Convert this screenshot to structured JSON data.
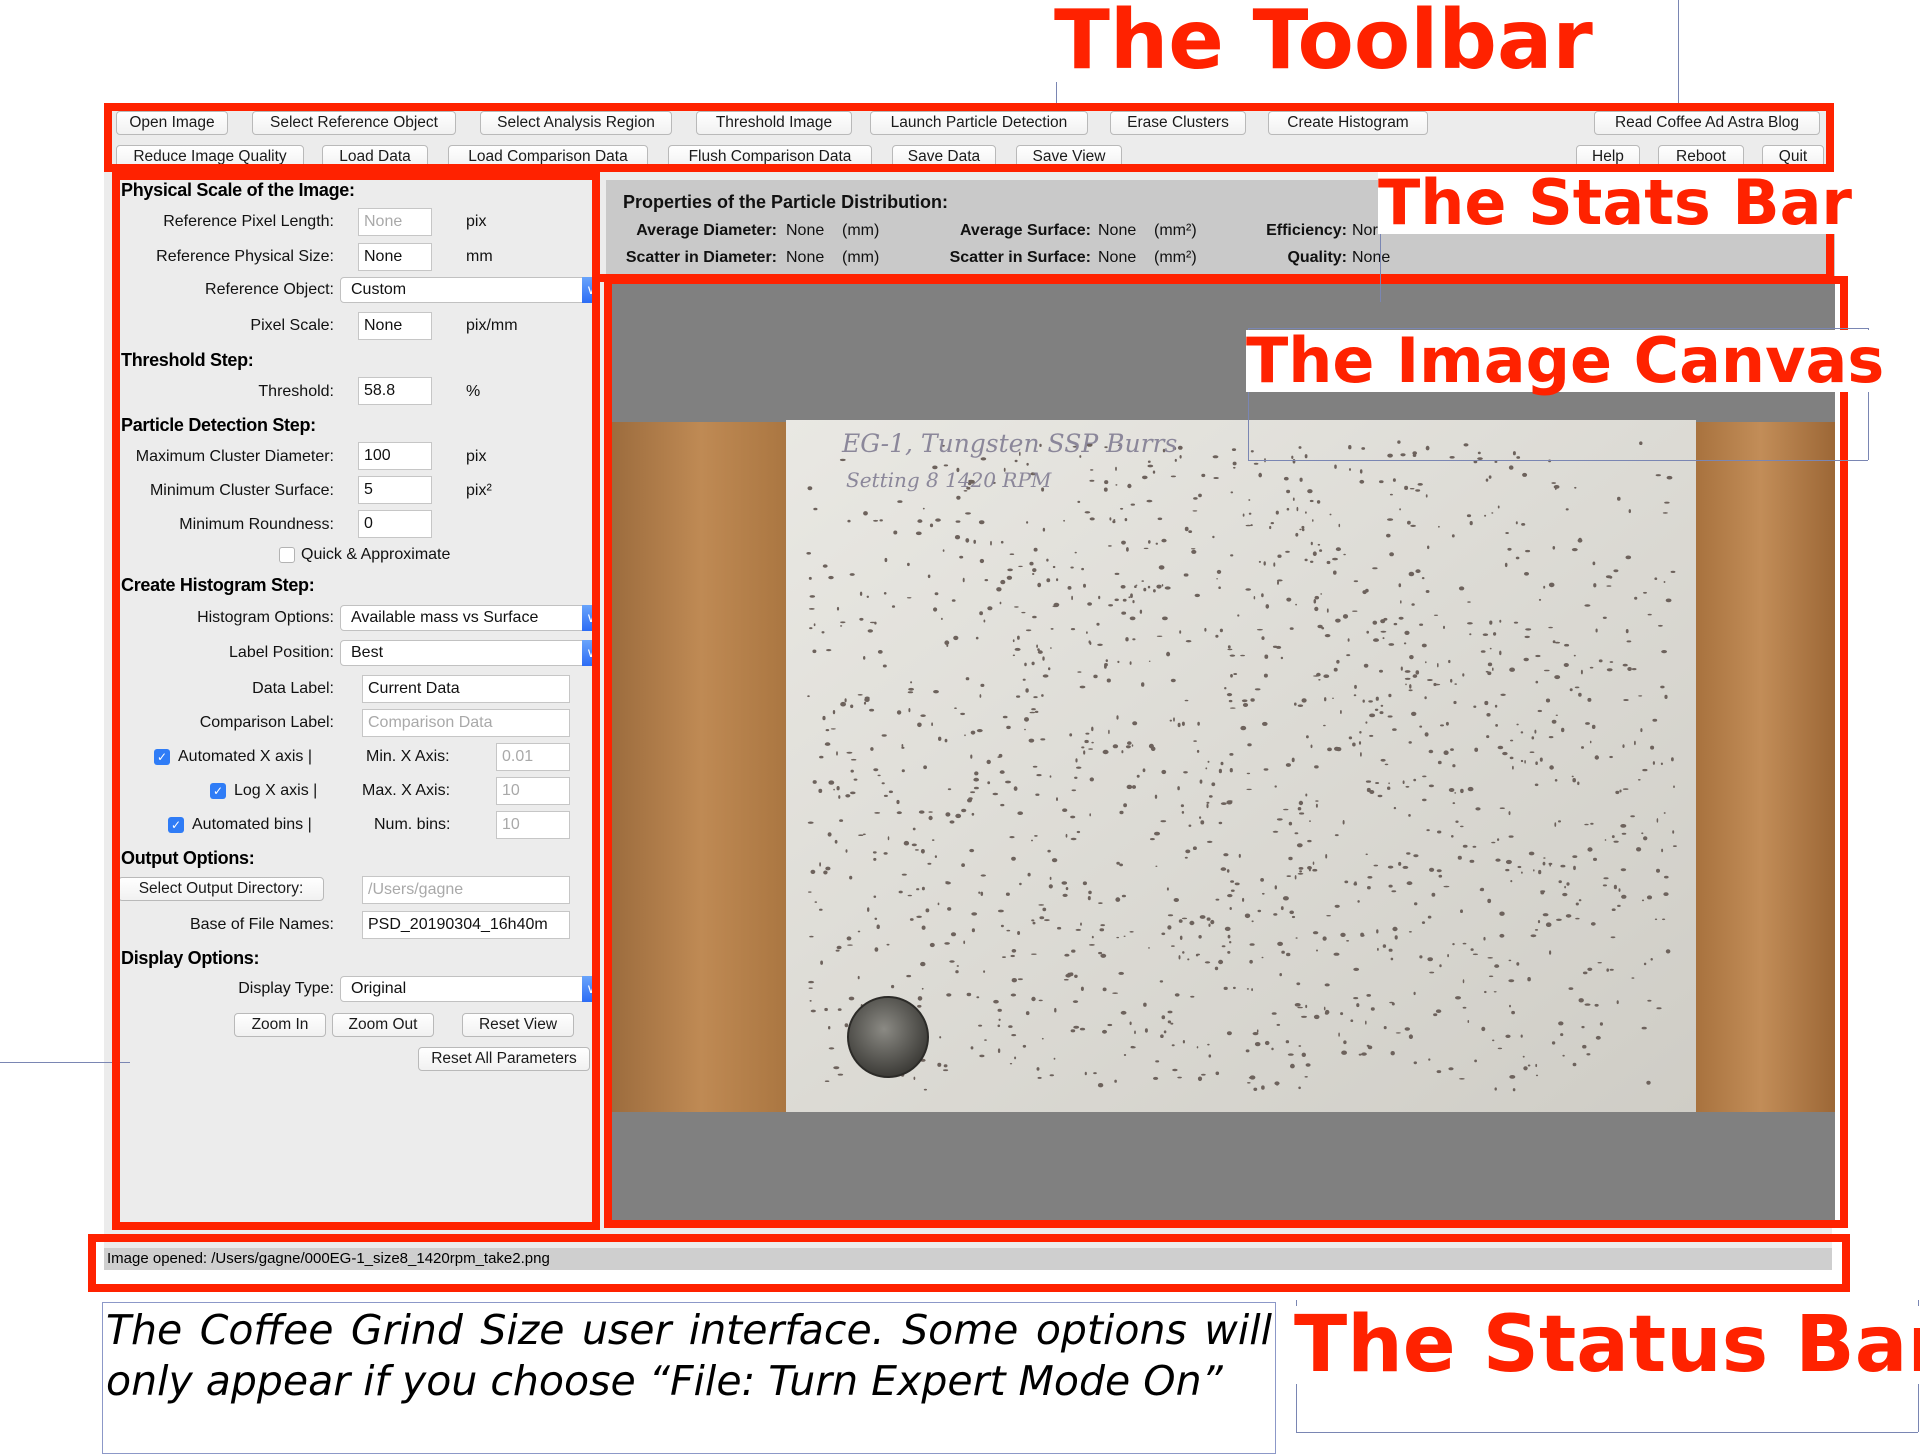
{
  "annotations": {
    "toolbar_title": "The Toolbar",
    "stats_title": "The Stats Bar",
    "canvas_title": "The Image Canvas",
    "status_title": "The Status Bar",
    "caption": "The Coffee Grind Size user interface. Some options will only appear if you choose “File: Turn Expert Mode On”",
    "highlight_color": "#ff2200"
  },
  "toolbar": {
    "row1": [
      "Open Image",
      "Select Reference Object",
      "Select Analysis Region",
      "Threshold Image",
      "Launch Particle Detection",
      "Erase Clusters",
      "Create Histogram",
      "Read Coffee Ad Astra Blog"
    ],
    "row2": [
      "Reduce Image Quality",
      "Load Data",
      "Load Comparison Data",
      "Flush Comparison Data",
      "Save Data",
      "Save View",
      "Help",
      "Reboot",
      "Quit"
    ]
  },
  "panel": {
    "physical_title": "Physical Scale of the Image:",
    "ref_pixel_length_label": "Reference Pixel Length:",
    "ref_pixel_length_value": "None",
    "ref_pixel_length_unit": "pix",
    "ref_physical_size_label": "Reference Physical Size:",
    "ref_physical_size_value": "None",
    "ref_physical_size_unit": "mm",
    "ref_object_label": "Reference Object:",
    "ref_object_value": "Custom",
    "pixel_scale_label": "Pixel Scale:",
    "pixel_scale_value": "None",
    "pixel_scale_unit": "pix/mm",
    "threshold_title": "Threshold Step:",
    "threshold_label": "Threshold:",
    "threshold_value": "58.8",
    "threshold_unit": "%",
    "particle_title": "Particle Detection Step:",
    "max_cluster_label": "Maximum Cluster Diameter:",
    "max_cluster_value": "100",
    "max_cluster_unit": "pix",
    "min_surface_label": "Minimum Cluster Surface:",
    "min_surface_value": "5",
    "min_surface_unit": "pix²",
    "min_roundness_label": "Minimum Roundness:",
    "min_roundness_value": "0",
    "quick_label": "Quick & Approximate",
    "histogram_title": "Create Histogram Step:",
    "hist_options_label": "Histogram Options:",
    "hist_options_value": "Available mass vs Surface",
    "label_position_label": "Label Position:",
    "label_position_value": "Best",
    "data_label_label": "Data Label:",
    "data_label_value": "Current Data",
    "comparison_label_label": "Comparison Label:",
    "comparison_label_placeholder": "Comparison Data",
    "auto_x_label": "Automated X axis |",
    "min_x_label": "Min. X Axis:",
    "min_x_value": "0.01",
    "log_x_label": "Log X axis |",
    "max_x_label": "Max. X Axis:",
    "max_x_value": "10",
    "auto_bins_label": "Automated bins |",
    "num_bins_label": "Num. bins:",
    "num_bins_value": "10",
    "output_title": "Output Options:",
    "select_output_button": "Select Output Directory:",
    "output_dir_value": "/Users/gagne",
    "base_names_label": "Base of File Names:",
    "base_names_value": "PSD_20190304_16h40m",
    "display_title": "Display Options:",
    "display_type_label": "Display Type:",
    "display_type_value": "Original",
    "zoom_in": "Zoom In",
    "zoom_out": "Zoom Out",
    "reset_view": "Reset View",
    "reset_all": "Reset All Parameters"
  },
  "stats": {
    "title": "Properties of the Particle Distribution:",
    "avg_diameter_label": "Average Diameter:",
    "avg_diameter_value": "None",
    "avg_diameter_unit": "(mm)",
    "scatter_diameter_label": "Scatter in Diameter:",
    "scatter_diameter_value": "None",
    "scatter_diameter_unit": "(mm)",
    "avg_surface_label": "Average Surface:",
    "avg_surface_value": "None",
    "avg_surface_unit": "(mm²)",
    "scatter_surface_label": "Scatter in Surface:",
    "scatter_surface_value": "None",
    "scatter_surface_unit": "(mm²)",
    "efficiency_label": "Efficiency:",
    "efficiency_value": "Nor",
    "quality_label": "Quality:",
    "quality_value": "None"
  },
  "canvas": {
    "note_line1": "EG-1, Tungsten SSP Burrs",
    "note_line2": "Setting 8 1420 RPM"
  },
  "status": {
    "text": "Image opened: /Users/gagne/000EG-1_size8_1420rpm_take2.png"
  }
}
